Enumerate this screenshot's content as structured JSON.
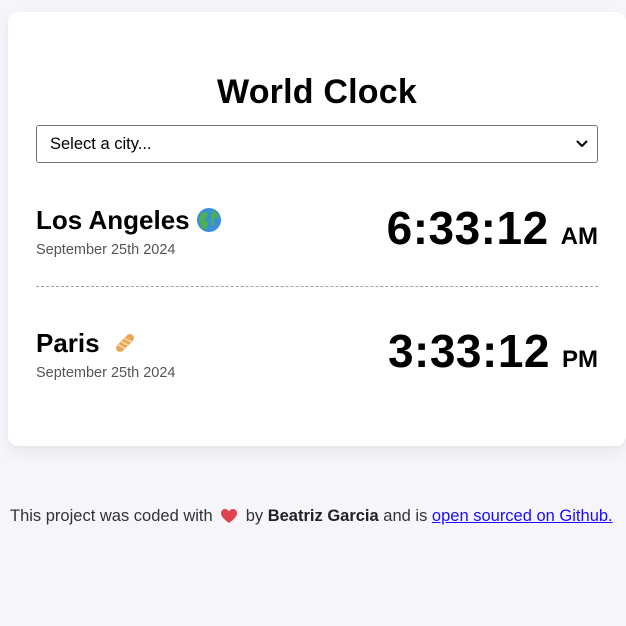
{
  "app": {
    "title": "World Clock"
  },
  "city_select": {
    "selected_value": "Select a city..."
  },
  "cities": [
    {
      "name": "Los Angeles",
      "icon": "globe-americas-icon",
      "date": "September 25th 2024",
      "time": "6:33:12",
      "ampm": "AM"
    },
    {
      "name": "Paris",
      "icon": "baguette-icon",
      "date": "September 25th 2024",
      "time": "3:33:12",
      "ampm": "PM"
    }
  ],
  "footer": {
    "prefix": "This project was coded with",
    "heart_icon": "heart-icon",
    "by_text": "by",
    "author": "Beatriz Garcia",
    "middle_text": "and is",
    "link_text": "open sourced on Github."
  },
  "colors": {
    "background": "#f6f5fa",
    "card": "#ffffff",
    "link": "#1a0dff",
    "heart": "#e0424f",
    "date_text": "#555555"
  }
}
